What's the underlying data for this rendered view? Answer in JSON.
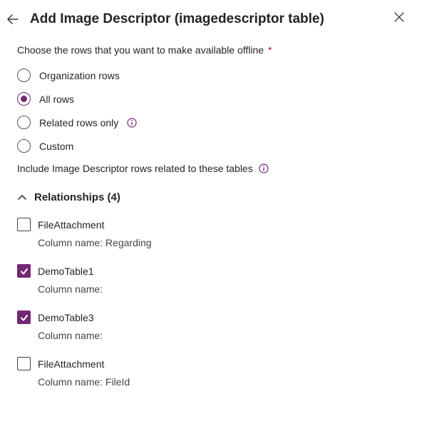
{
  "header": {
    "title": "Add Image Descriptor (imagedescriptor table)"
  },
  "section": {
    "choose_label": "Choose the rows that you want to make available offline",
    "required_marker": "*"
  },
  "radios": {
    "selected": 1,
    "options": [
      {
        "label": "Organization rows",
        "info": false
      },
      {
        "label": "All rows",
        "info": false
      },
      {
        "label": "Related rows only",
        "info": true
      },
      {
        "label": "Custom",
        "info": false
      }
    ]
  },
  "include": {
    "label": "Include Image Descriptor rows related to these tables"
  },
  "relationships": {
    "heading": "Relationships (4)",
    "column_label": "Column name:",
    "items": [
      {
        "name": "FileAttachment",
        "checked": false,
        "column": "Regarding"
      },
      {
        "name": "DemoTable1",
        "checked": true,
        "column": ""
      },
      {
        "name": "DemoTable3",
        "checked": true,
        "column": ""
      },
      {
        "name": "FileAttachment",
        "checked": false,
        "column": "FileId"
      }
    ]
  }
}
